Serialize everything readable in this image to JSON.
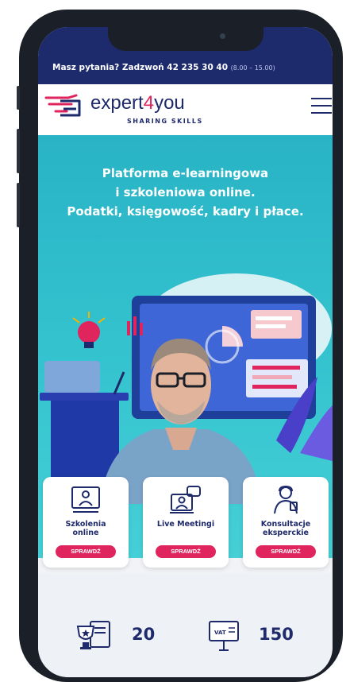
{
  "topbar": {
    "question": "Masz pytania? Zadzwoń 42 235 30 40",
    "hours": "(8.00 – 15.00)"
  },
  "header": {
    "brand_part1": "expert",
    "brand_part2": "4",
    "brand_part3": "you",
    "tagline": "SHARING SKILLS"
  },
  "hero": {
    "line1": "Platforma e-learningowa",
    "line2": "i szkoleniowa online.",
    "line3": "Podatki, księgowość, kadry i płace."
  },
  "cards": [
    {
      "title_line1": "Szkolenia",
      "title_line2": "online",
      "cta": "SPRAWDŹ"
    },
    {
      "title_line1": "Live Meetingi",
      "title_line2": "",
      "cta": "SPRAWDŹ"
    },
    {
      "title_line1": "Konsultacje",
      "title_line2": "eksperckie",
      "cta": "SPRAWDŹ"
    }
  ],
  "stats": [
    {
      "value": "20",
      "icon": "trophy-certificate-icon"
    },
    {
      "value": "150",
      "icon": "vat-presentation-icon"
    }
  ],
  "colors": {
    "navy": "#1d2a6c",
    "accent": "#e0245e",
    "teal": "#35c4cf"
  }
}
